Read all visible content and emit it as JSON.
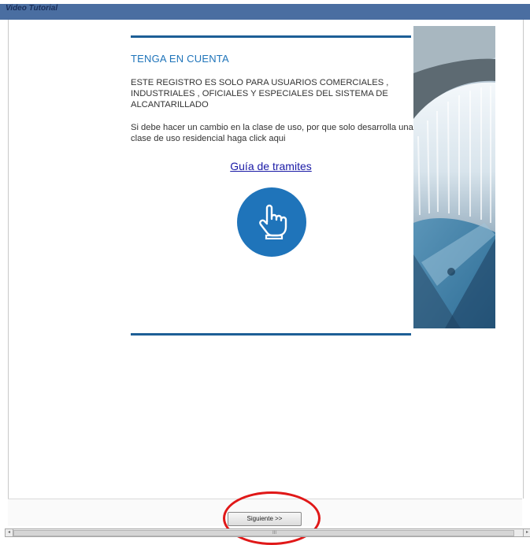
{
  "window": {
    "title": "Video Tutorial"
  },
  "notice": {
    "heading": "TENGA EN CUENTA",
    "line1": "ESTE REGISTRO ES SOLO PARA USUARIOS COMERCIALES , INDUSTRIALES , OFICIALES Y ESPECIALES DEL SISTEMA DE ALCANTARILLADO",
    "line2": "Si debe hacer un cambio en la clase de uso, por que solo desarrolla una clase de uso residencial haga click aqui",
    "link": "Guía de tramites",
    "icon": "hand-pointer-icon"
  },
  "footer": {
    "next_label": "Siguiente >>"
  },
  "scrollbar": {
    "grip": "III",
    "left_arrow": "◂",
    "right_arrow": "▸"
  },
  "colors": {
    "accent": "#1f74ba",
    "rule": "#1d5f96",
    "titlebar": "#4a6ea1",
    "highlight": "#e01818"
  }
}
